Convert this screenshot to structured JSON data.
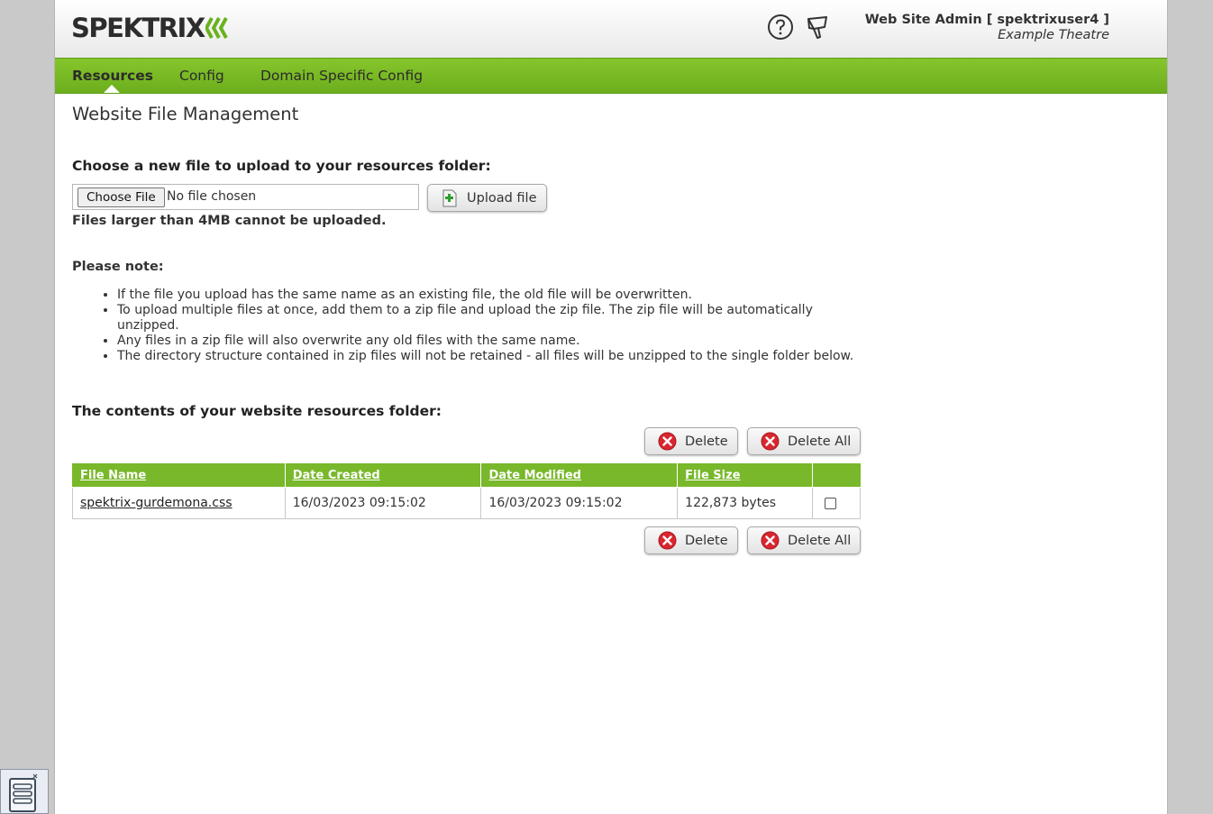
{
  "header": {
    "logo_text": "SPEKTRIX",
    "user_line": "Web Site Admin [ spektrixuser4 ]",
    "organization": "Example Theatre"
  },
  "nav": {
    "items": [
      {
        "label": "Resources",
        "active": true
      },
      {
        "label": "Config",
        "active": false
      },
      {
        "label": "Domain Specific Config",
        "active": false
      }
    ]
  },
  "page_title": "Website File Management",
  "upload": {
    "heading": "Choose a new file to upload to your resources folder:",
    "choose_file_label": "Choose File",
    "no_file_text": "No file chosen",
    "upload_button_label": "Upload file",
    "size_note": "Files larger than 4MB cannot be uploaded."
  },
  "notes": {
    "heading": "Please note:",
    "items": [
      "If the file you upload has the same name as an existing file, the old file will be overwritten.",
      "To upload multiple files at once, add them to a zip file and upload the zip file. The zip file will be automatically unzipped.",
      "Any files in a zip file will also overwrite any old files with the same name.",
      "The directory structure contained in zip files will not be retained - all files will be unzipped to the single folder below."
    ]
  },
  "contents": {
    "heading": "The contents of your website resources folder:",
    "delete_label": "Delete",
    "delete_all_label": "Delete All",
    "columns": [
      "File Name",
      "Date Created",
      "Date Modified",
      "File Size"
    ],
    "rows": [
      {
        "file_name": "spektrix-gurdemona.css",
        "date_created": "16/03/2023 09:15:02",
        "date_modified": "16/03/2023 09:15:02",
        "file_size": "122,873 bytes",
        "checked": false
      }
    ]
  },
  "colors": {
    "brand_green": "#78b82a",
    "delete_red": "#d9262f"
  }
}
